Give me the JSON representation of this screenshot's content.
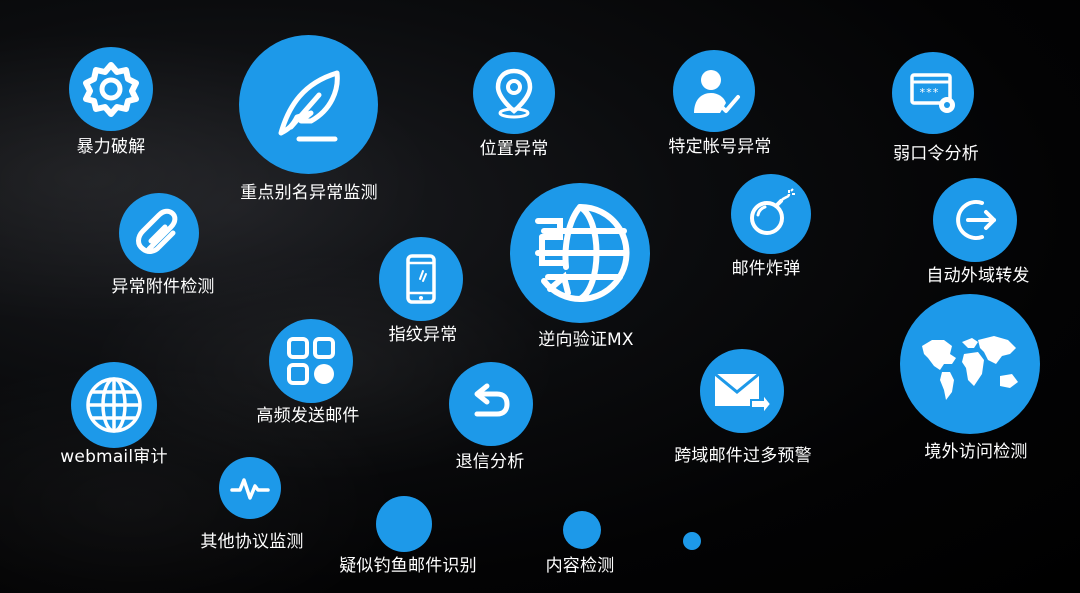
{
  "colors": {
    "accent": "#1d99e9",
    "background": "#000000",
    "text": "#ffffff"
  },
  "features": {
    "brute_force": {
      "label": "暴力破解",
      "icon": "gear-icon"
    },
    "alias_monitor": {
      "label": "重点别名异常监测",
      "icon": "feather-icon"
    },
    "location_anomaly": {
      "label": "位置异常",
      "icon": "location-pin-icon"
    },
    "account_anomaly": {
      "label": "特定帐号异常",
      "icon": "user-check-icon"
    },
    "weak_password": {
      "label": "弱口令分析",
      "icon": "password-settings-icon"
    },
    "attachment_detect": {
      "label": "异常附件检测",
      "icon": "paperclip-icon"
    },
    "mail_bomb": {
      "label": "邮件炸弹",
      "icon": "bomb-icon"
    },
    "auto_forward": {
      "label": "自动外域转发",
      "icon": "exit-arrow-icon"
    },
    "fingerprint_anomaly": {
      "label": "指纹异常",
      "icon": "mobile-phone-icon"
    },
    "reverse_mx": {
      "label": "逆向验证MX",
      "icon": "globe-verify-icon"
    },
    "high_freq_send": {
      "label": "高频发送邮件",
      "icon": "grid-apps-icon"
    },
    "webmail_audit": {
      "label": "webmail审计",
      "icon": "globe-icon"
    },
    "bounce_analysis": {
      "label": "退信分析",
      "icon": "return-arrow-icon"
    },
    "cross_domain_alert": {
      "label": "跨域邮件过多预警",
      "icon": "mail-forward-icon"
    },
    "overseas_access": {
      "label": "境外访问检测",
      "icon": "world-map-icon"
    },
    "other_protocols": {
      "label": "其他协议监测",
      "icon": "pulse-icon"
    },
    "phishing_detect": {
      "label": "疑似钓鱼邮件识别",
      "icon": ""
    },
    "content_detect": {
      "label": "内容检测",
      "icon": ""
    }
  }
}
